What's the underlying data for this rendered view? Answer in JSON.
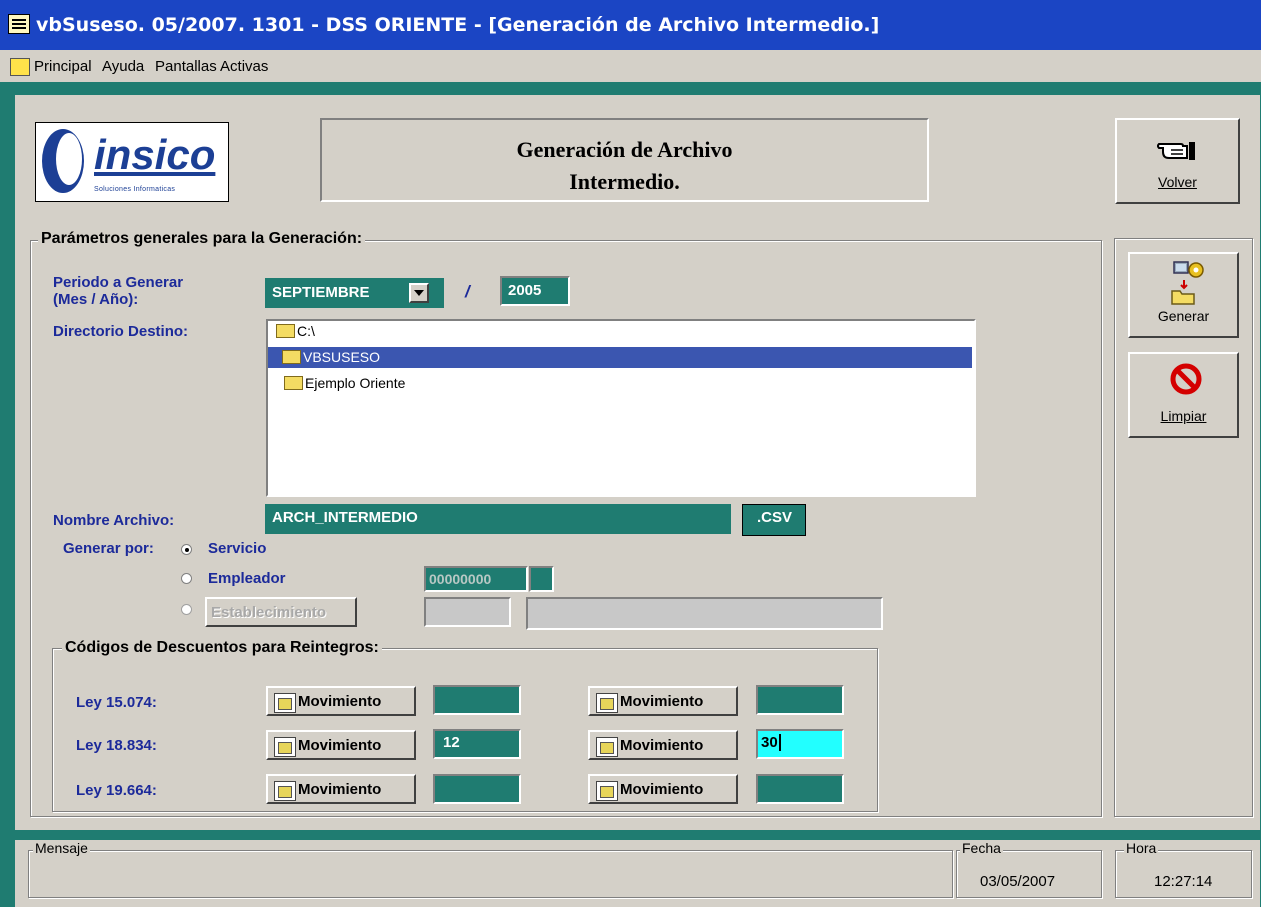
{
  "window": {
    "title": "vbSuseso. 05/2007. 1301 - DSS ORIENTE - [Generación de Archivo Intermedio.]"
  },
  "menu": {
    "items": [
      "Principal",
      "Ayuda",
      "Pantallas Activas"
    ]
  },
  "logo": {
    "text": "insico",
    "subtitle": "Soluciones Informaticas"
  },
  "header": {
    "title": "Generación de Archivo\nIntermedio."
  },
  "toolbar": {
    "volver": "Volver",
    "generar": "Generar",
    "limpiar": "Limpiar"
  },
  "params": {
    "group_title": "Parámetros generales para la Generación:",
    "periodo_label": "Periodo a Generar\n(Mes / Año):",
    "month": "SEPTIEMBRE",
    "separator": "/",
    "year": "2005",
    "directorio_label": "Directorio Destino:",
    "dir_tree": [
      "C:\\",
      "VBSUSESO",
      "Ejemplo Oriente"
    ],
    "nombre_label": "Nombre Archivo:",
    "nombre_value": "ARCH_INTERMEDIO",
    "extension": ".CSV",
    "generar_por_label": "Generar por:",
    "opt_servicio": "Servicio",
    "opt_empleador": "Empleador",
    "empleador_code": "00000000",
    "opt_establecimiento": "Establecimiento"
  },
  "codigos": {
    "group_title": "Códigos de Descuentos para Reintegros:",
    "button_label": "Movimiento",
    "rows": [
      {
        "label": "Ley 15.074:",
        "v1": "",
        "v2": ""
      },
      {
        "label": "Ley 18.834:",
        "v1": "12",
        "v2": "30"
      },
      {
        "label": "Ley 19.664:",
        "v1": "",
        "v2": ""
      }
    ]
  },
  "status": {
    "mensaje_label": "Mensaje",
    "fecha_label": "Fecha",
    "fecha_value": "03/05/2007",
    "hora_label": "Hora",
    "hora_value": "12:27:14"
  }
}
